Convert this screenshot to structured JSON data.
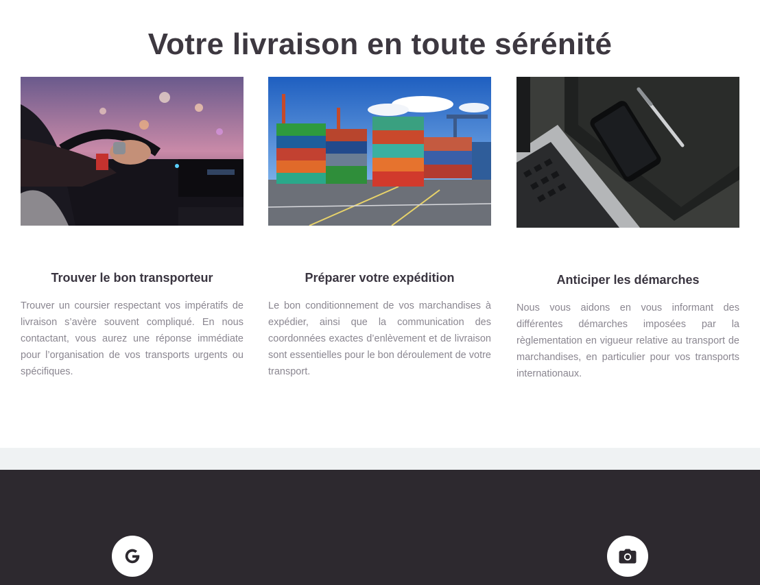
{
  "hero": {
    "title": "Votre livraison en toute sérénité"
  },
  "cards": [
    {
      "image": "driver-steering-wheel-photo",
      "title": "Trouver le bon transporteur",
      "text": "Trouver un coursier respectant vos impératifs de livraison s’avère souvent compliqué. En nous contactant, vous aurez une réponse immédiate pour l’organisation de vos transports urgents ou spécifiques."
    },
    {
      "image": "shipping-containers-photo",
      "title": "Préparer votre expédition",
      "text": "Le bon conditionnement de vos marchandises à expédier, ainsi que la communication des coordonnées exactes d’enlèvement et de livraison sont essentielles pour le bon déroulement de votre transport."
    },
    {
      "image": "laptop-phone-notebook-photo",
      "title": "Anticiper les démarches",
      "text": "Nous vous aidons en vous informant des différentes démarches imposées par la règlementation en vigueur relative au transport de marchandises, en particulier pour vos transports internationaux."
    }
  ],
  "footer": {
    "icons": [
      "google-icon",
      "camera-icon"
    ]
  },
  "colors": {
    "title": "#3d3840",
    "body_text": "#8a8690",
    "band": "#eff2f3",
    "footer": "#2d292f"
  }
}
